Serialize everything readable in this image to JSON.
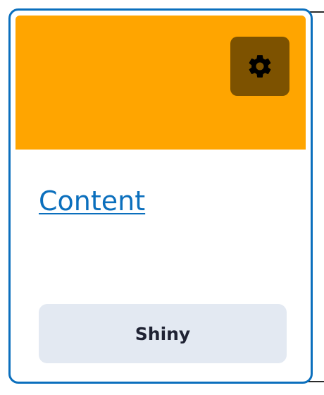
{
  "card": {
    "title": "Content",
    "action_label": "Shiny",
    "settings_icon": "gear-icon",
    "colors": {
      "border": "#0b6fbd",
      "header": "#ffa500",
      "settings_button": "#7d5200",
      "title_link": "#0b6fbd",
      "action_background": "#e3e9f2",
      "action_text": "#1f2233"
    }
  }
}
